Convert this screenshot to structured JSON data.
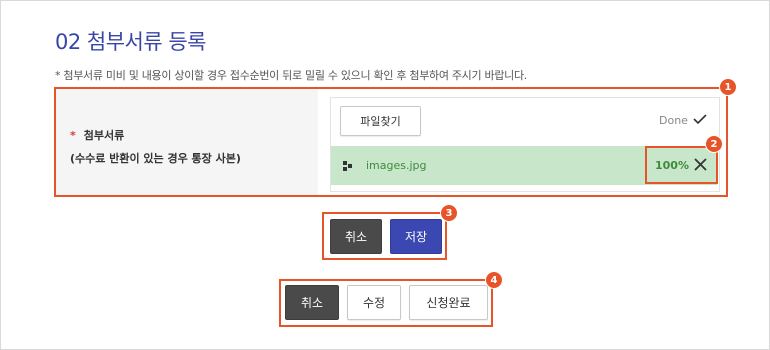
{
  "title": "02 첨부서류 등록",
  "notice": "* 첨부서류 미비 및 내용이 상이할 경우 접수순번이 뒤로 밀릴 수 있으니 확인 후 첨부하여 주시기 바랍니다.",
  "form": {
    "required_mark": "*",
    "label": "첨부서류",
    "sublabel": "(수수료 반환이 있는 경우 통장 사본)"
  },
  "upload": {
    "browse_label": "파일찾기",
    "status_text": "Done",
    "status_icon": "check-icon",
    "file": {
      "icon": "file-icon",
      "name": "images.jpg",
      "progress_text": "100%",
      "progress": 1.0,
      "remove_icon": "close-icon"
    }
  },
  "actions_upload": {
    "cancel_label": "취소",
    "save_label": "저장"
  },
  "actions_main": {
    "cancel_label": "취소",
    "edit_label": "수정",
    "complete_label": "신청완료"
  },
  "badges": [
    "1",
    "2",
    "3",
    "4"
  ],
  "colors": {
    "accent": "#e8542a",
    "title": "#3a45a8",
    "primary_button": "#3c48b2",
    "dark_button": "#4a4a4a",
    "file_row": "#c8e6c9",
    "file_text": "#3d8b3d"
  }
}
